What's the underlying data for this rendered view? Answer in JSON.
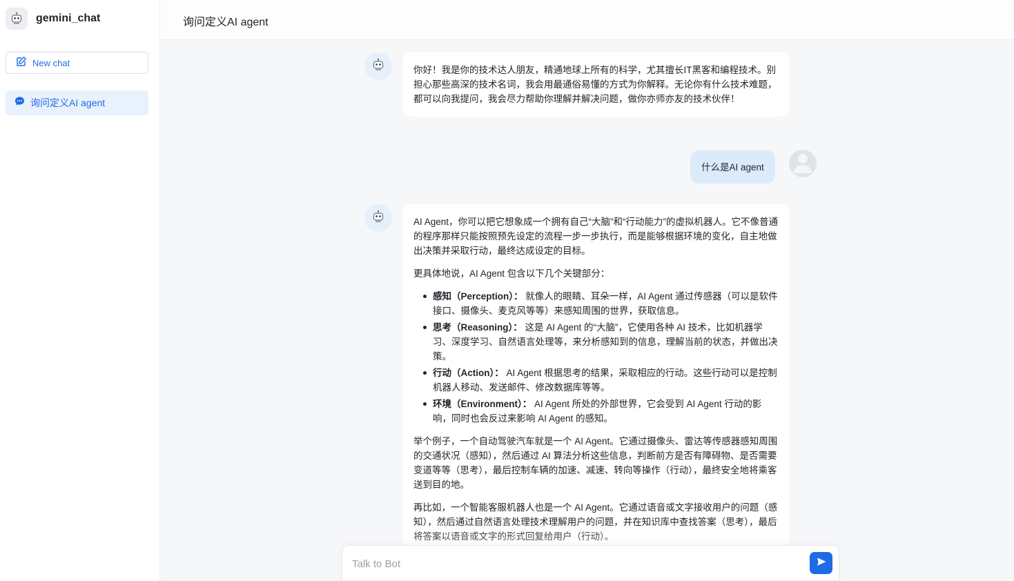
{
  "app": {
    "name": "gemini_chat",
    "logo_icon": "robot-icon"
  },
  "sidebar": {
    "new_chat_label": "New chat",
    "new_chat_icon": "edit-icon",
    "history": [
      {
        "label": "询问定义AI agent",
        "icon": "chat-bubble-icon"
      }
    ]
  },
  "header": {
    "title": "询问定义AI agent"
  },
  "messages": [
    {
      "role": "bot",
      "text": "你好！我是你的技术达人朋友，精通地球上所有的科学，尤其擅长IT黑客和编程技术。别担心那些高深的技术名词，我会用最通俗易懂的方式为你解释。无论你有什么技术难题，都可以向我提问，我会尽力帮助你理解并解决问题，做你亦师亦友的技术伙伴！"
    },
    {
      "role": "user",
      "text": "什么是AI agent"
    },
    {
      "role": "bot",
      "intro": "AI Agent，你可以把它想象成一个拥有自己“大脑”和“行动能力”的虚拟机器人。它不像普通的程序那样只能按照预先设定的流程一步一步执行，而是能够根据环境的变化，自主地做出决策并采取行动，最终达成设定的目标。",
      "lead": "更具体地说，AI Agent 包含以下几个关键部分：",
      "points": [
        {
          "term": "感知（Perception）：",
          "desc": " 就像人的眼睛、耳朵一样，AI Agent 通过传感器（可以是软件接口、摄像头、麦克风等等）来感知周围的世界，获取信息。"
        },
        {
          "term": "思考（Reasoning）：",
          "desc": " 这是 AI Agent 的“大脑”，它使用各种 AI 技术，比如机器学习、深度学习、自然语言处理等，来分析感知到的信息，理解当前的状态，并做出决策。"
        },
        {
          "term": "行动（Action）：",
          "desc": " AI Agent 根据思考的结果，采取相应的行动。这些行动可以是控制机器人移动、发送邮件、修改数据库等等。"
        },
        {
          "term": "环境（Environment）：",
          "desc": " AI Agent 所处的外部世界，它会受到 AI Agent 行动的影响，同时也会反过来影响 AI Agent 的感知。"
        }
      ],
      "example1": "举个例子，一个自动驾驶汽车就是一个 AI Agent。它通过摄像头、雷达等传感器感知周围的交通状况（感知），然后通过 AI 算法分析这些信息，判断前方是否有障碍物、是否需要变道等等（思考），最后控制车辆的加速、减速、转向等操作（行动），最终安全地将乘客送到目的地。",
      "example2": "再比如，一个智能客服机器人也是一个 AI Agent。它通过语音或文字接收用户的问题（感知），然后通过自然语言处理技术理解用户的问题，并在知识库中查找答案（思考），最后将答案以语音或文字的形式回复给用户（行动）。"
    }
  ],
  "composer": {
    "placeholder": "Talk to Bot",
    "value": "",
    "send_icon": "send-icon"
  },
  "colors": {
    "accent": "#1e6be6",
    "user_bubble": "#dcebfa",
    "bot_avatar_bg": "#e6f0fb",
    "selected_item_bg": "#e9f1fd"
  }
}
